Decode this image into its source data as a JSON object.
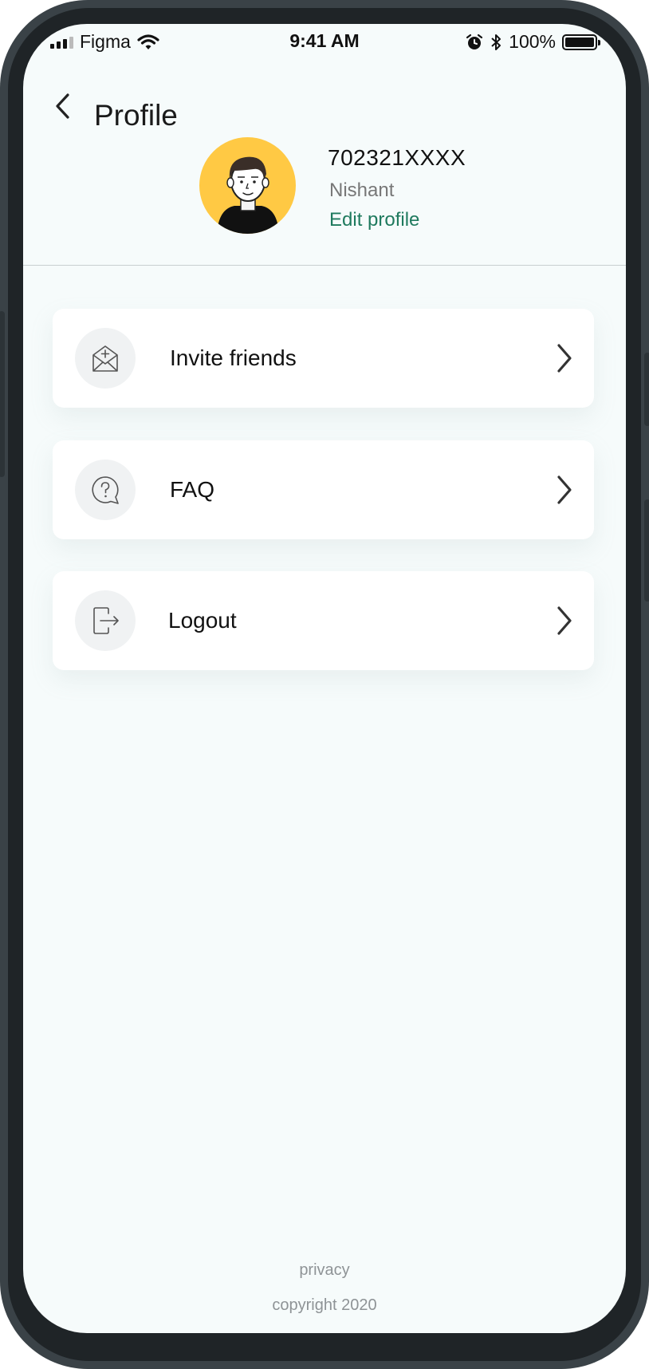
{
  "status_bar": {
    "carrier": "Figma",
    "time": "9:41 AM",
    "battery": "100%",
    "icons": [
      "signal-icon",
      "wifi-icon",
      "alarm-icon",
      "bluetooth-icon",
      "battery-icon"
    ]
  },
  "header": {
    "title": "Profile",
    "back_icon": "chevron-left-icon"
  },
  "profile": {
    "phone": "702321XXXX",
    "name": "Nishant",
    "edit_label": "Edit profile",
    "avatar_bg": "#ffc944"
  },
  "menu": {
    "items": [
      {
        "label": "Invite friends",
        "icon": "envelope-plus-icon"
      },
      {
        "label": "FAQ",
        "icon": "question-bubble-icon"
      },
      {
        "label": "Logout",
        "icon": "logout-icon"
      }
    ]
  },
  "footer": {
    "privacy": "privacy",
    "copyright": "copyright 2020"
  },
  "colors": {
    "accent": "#1f7a5e",
    "screen_bg": "#f6fbfb",
    "frame": "#3a4247"
  }
}
